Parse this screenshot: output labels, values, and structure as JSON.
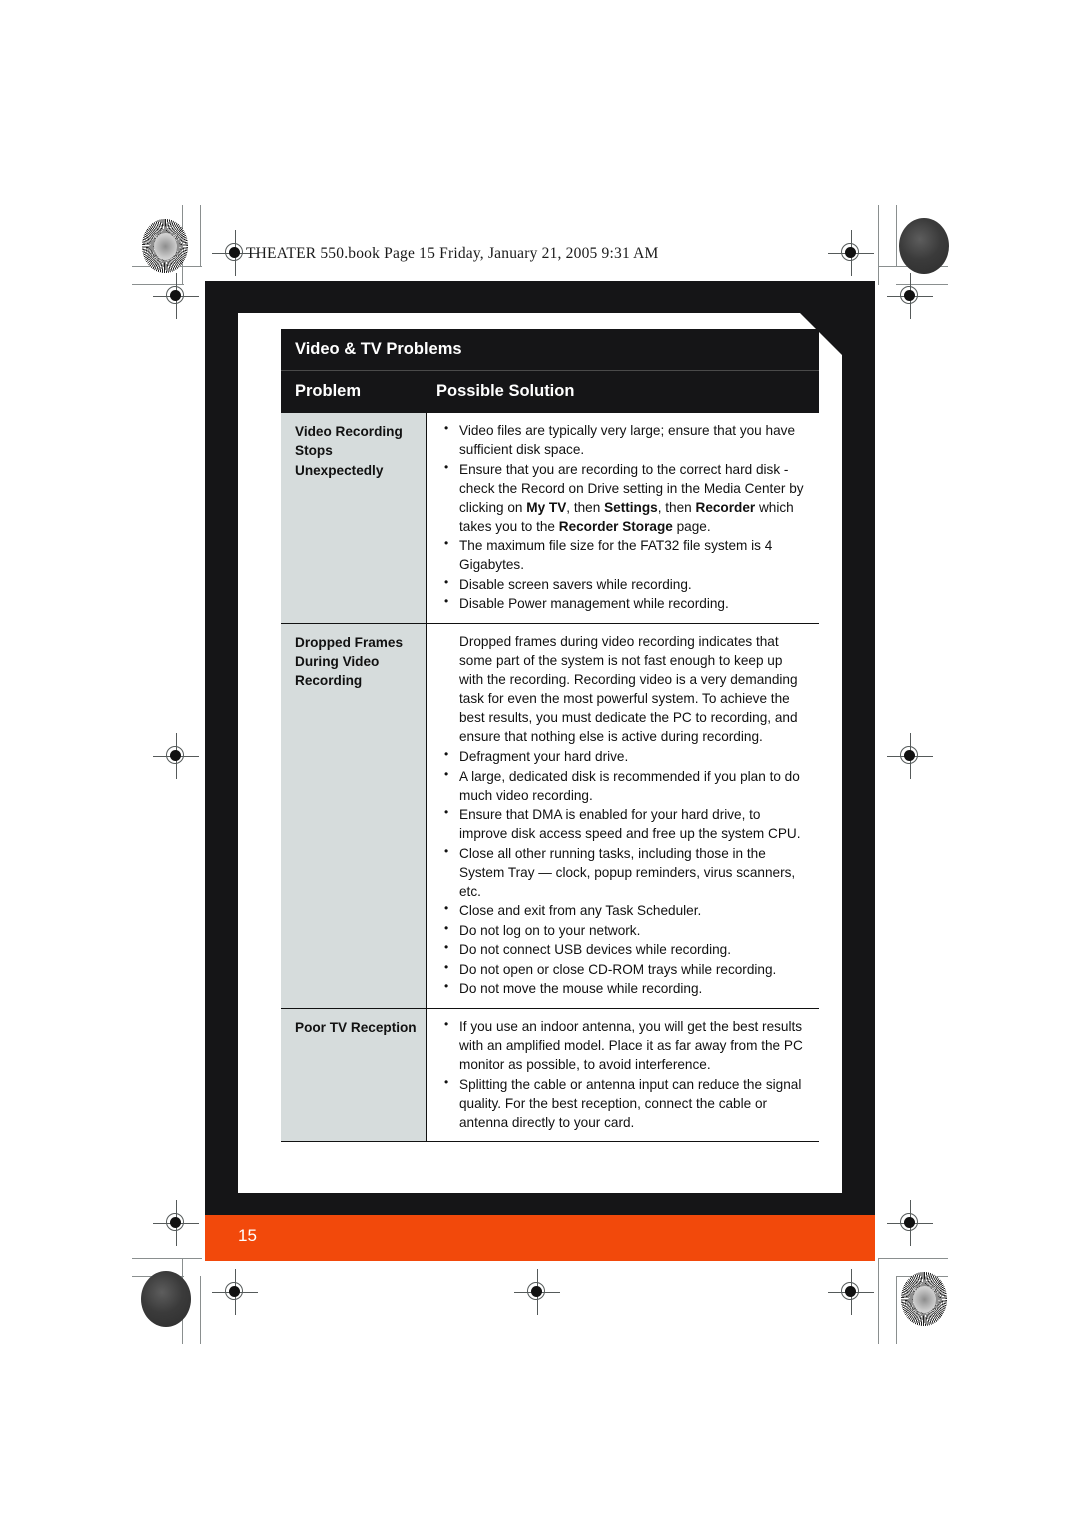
{
  "book_header": "THEATER 550.book  Page 15  Friday, January 21, 2005  9:31 AM",
  "page_number": "15",
  "colors": {
    "footer_orange": "#F2490B",
    "frame_black": "#151517",
    "problem_cell_gray": "#D6DCDC"
  },
  "table": {
    "title": "Video & TV Problems",
    "columns": {
      "problem": "Problem",
      "solution": "Possible Solution"
    },
    "rows": [
      {
        "problem": "Video Recording Stops Unexpectedly",
        "intro": "",
        "bullets": [
          "Video files are typically very large; ensure that you have sufficient disk space.",
          "Ensure that you are recording to the correct hard disk - check the Record on Drive setting in the Media Center by clicking on <b>My TV</b>, then <b>Settings</b>, then <b>Recorder</b> which takes you to the <b>Recorder Storage</b> page.",
          "The maximum file size for the FAT32 file system is 4 Gigabytes.",
          "Disable screen savers while recording.",
          "Disable Power management while recording."
        ]
      },
      {
        "problem": "Dropped Frames During Video Recording",
        "intro": "Dropped frames during video recording indicates that some part of the system is not fast enough to keep up with the recording. Recording video is a very demanding task for even the most powerful system. To achieve the best results, you must dedicate the PC to recording, and ensure that nothing else is active during recording.",
        "bullets": [
          "Defragment your hard drive.",
          "A large, dedicated disk is recommended if you plan to do much video recording.",
          "Ensure that DMA is enabled for your hard drive, to improve disk access speed and free up the system CPU.",
          "Close all other running tasks, including those in the System Tray — clock, popup reminders, virus scanners, etc.",
          "Close and exit from any Task Scheduler.",
          "Do not log on to your network.",
          "Do not connect USB devices while recording.",
          "Do not open or close CD-ROM trays while recording.",
          "Do not move the mouse while recording."
        ]
      },
      {
        "problem": "Poor TV Reception",
        "intro": "",
        "bullets": [
          "If you use an indoor antenna, you will get the best results with an amplified model. Place it as far away from the PC monitor as possible, to avoid interference.",
          "Splitting the cable or antenna input can reduce the signal quality. For the best reception, connect the cable or antenna directly to your card."
        ]
      }
    ]
  }
}
